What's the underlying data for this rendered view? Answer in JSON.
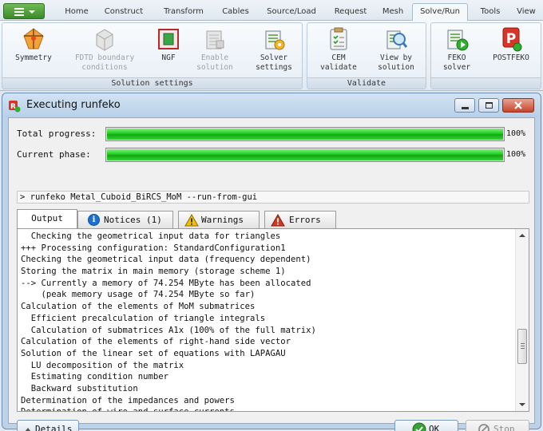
{
  "ribbon": {
    "tabs": [
      "Home",
      "Construct",
      "Transform",
      "Cables",
      "Source/Load",
      "Request",
      "Mesh",
      "Solve/Run",
      "Tools",
      "View"
    ],
    "active_tab": "Solve/Run",
    "groups": [
      {
        "label": "Solution settings",
        "buttons": [
          {
            "line1": "Symmetry",
            "line2": "",
            "icon": "symmetry-icon",
            "enabled": true
          },
          {
            "line1": "FDTD boundary",
            "line2": "conditions",
            "icon": "fdtd-boundary-icon",
            "enabled": false
          },
          {
            "line1": "NGF",
            "line2": "",
            "icon": "ngf-icon",
            "enabled": true
          },
          {
            "line1": "Enable",
            "line2": "solution",
            "icon": "enable-solution-icon",
            "enabled": false
          },
          {
            "line1": "Solver",
            "line2": "settings",
            "icon": "solver-settings-icon",
            "enabled": true
          }
        ]
      },
      {
        "label": "Validate",
        "buttons": [
          {
            "line1": "CEM",
            "line2": "validate",
            "icon": "cem-validate-icon",
            "enabled": true
          },
          {
            "line1": "View by",
            "line2": "solution",
            "icon": "view-by-solution-icon",
            "enabled": true
          }
        ]
      },
      {
        "label": "",
        "buttons": [
          {
            "line1": "FEKO",
            "line2": "solver",
            "icon": "feko-solver-icon",
            "enabled": true
          },
          {
            "line1": "POSTFEKO",
            "line2": "",
            "icon": "postfeko-icon",
            "enabled": true
          }
        ]
      }
    ]
  },
  "dialog": {
    "title": "Executing runfeko",
    "total_progress_label": "Total progress:",
    "total_progress_value": 1.0,
    "total_progress_text": "100%",
    "current_phase_label": "Current phase:",
    "current_phase_value": 1.0,
    "current_phase_text": "100%",
    "command_line": "> runfeko Metal_Cuboid_BiRCS_MoM --run-from-gui",
    "tabs": {
      "output": "Output",
      "notices": "Notices (1)",
      "warnings": "Warnings",
      "errors": "Errors"
    },
    "output_lines": [
      "  Checking the geometrical input data for triangles",
      "+++ Processing configuration: StandardConfiguration1",
      "Checking the geometrical input data (frequency dependent)",
      "Storing the matrix in main memory (storage scheme 1)",
      "--> Currently a memory of 74.254 MByte has been allocated",
      "    (peak memory usage of 74.254 MByte so far)",
      "Calculation of the elements of MoM submatrices",
      "  Efficient precalculation of triangle integrals",
      "  Calculation of submatrices A1x (100% of the full matrix)",
      "Calculation of the elements of right-hand side vector",
      "Solution of the linear set of equations with LAPAGAU",
      "  LU decomposition of the matrix",
      "  Estimating condition number",
      "  Backward substitution",
      "Determination of the impedances and powers",
      "Determination of wire and surface currents"
    ],
    "details_button": "Details",
    "ok_button": "OK",
    "stop_button": "Stop"
  },
  "colors": {
    "progress_green": "#1fcb1f",
    "accent_blue": "#1e6fd0",
    "warning_yellow": "#f2c200",
    "error_red": "#d23a20",
    "feko_red": "#d8352a"
  }
}
